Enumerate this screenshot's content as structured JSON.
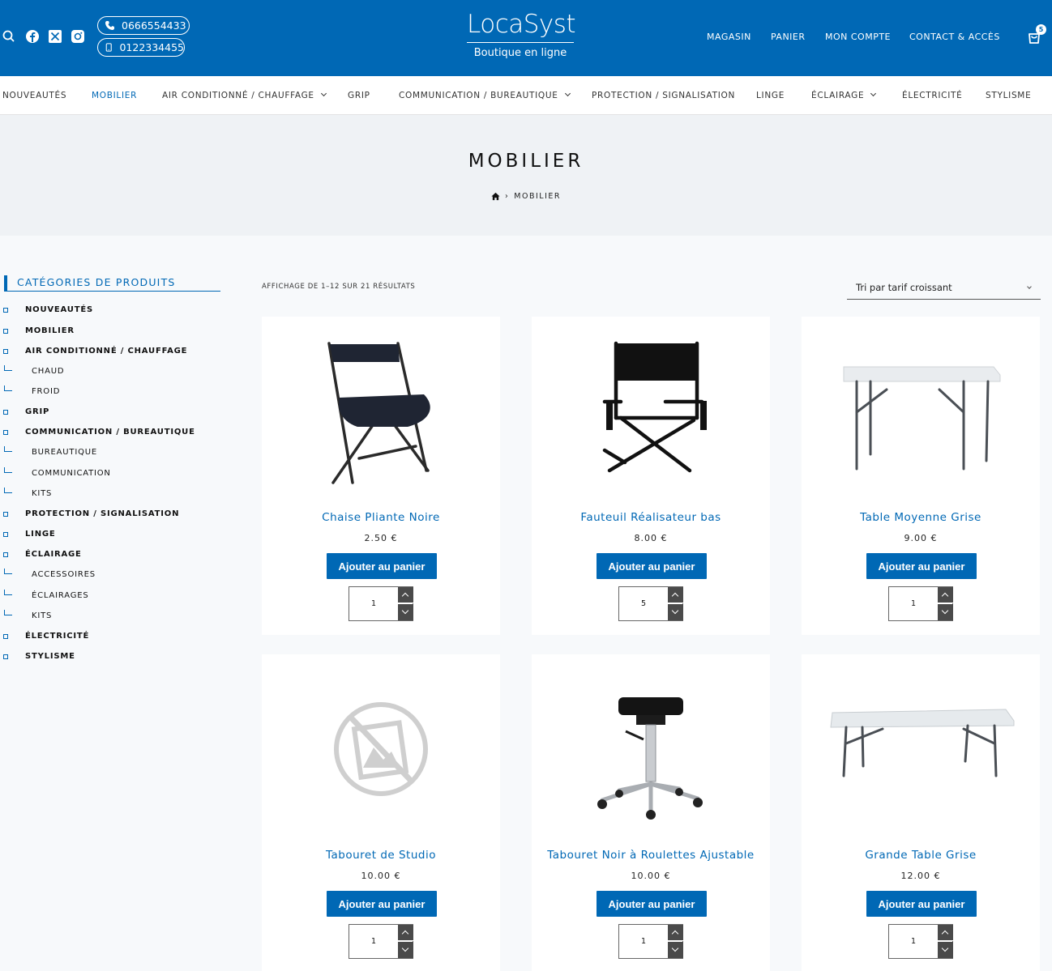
{
  "header": {
    "phone": "0666554433",
    "mobile": "0122334455",
    "logo_name": "LocaSyst",
    "logo_tagline": "Boutique en ligne",
    "nav": [
      "MAGASIN",
      "PANIER",
      "MON COMPTE",
      "CONTACT & ACCÈS"
    ],
    "cart_count": "5",
    "accent_color": "#0068b5"
  },
  "catnav": [
    "NOUVEAUTÉS",
    "MOBILIER",
    "AIR CONDITIONNÉ / CHAUFFAGE",
    "GRIP",
    "COMMUNICATION / BUREAUTIQUE",
    "PROTECTION / SIGNALISATION",
    "LINGE",
    "ÉCLAIRAGE",
    "ÉLECTRICITÉ",
    "STYLISME"
  ],
  "page": {
    "title": "MOBILIER",
    "breadcrumb": "MOBILIER"
  },
  "sidebar": {
    "title": "CATÉGORIES DE PRODUITS",
    "items": [
      "NOUVEAUTÉS",
      "MOBILIER",
      "AIR CONDITIONNÉ / CHAUFFAGE",
      "CHAUD",
      "FROID",
      "GRIP",
      "COMMUNICATION / BUREAUTIQUE",
      "BUREAUTIQUE",
      "COMMUNICATION",
      "KITS",
      "PROTECTION / SIGNALISATION",
      "LINGE",
      "ÉCLAIRAGE",
      "ACCESSOIRES",
      "ÉCLAIRAGES",
      "KITS",
      "ÉLECTRICITÉ",
      "STYLISME"
    ]
  },
  "toolbar": {
    "results": "AFFICHAGE DE 1–12 SUR 21 RÉSULTATS",
    "sort": "Tri par tarif croissant"
  },
  "products": [
    {
      "name": "Chaise Pliante Noire",
      "price": "2.50 €",
      "button": "Ajouter au panier",
      "qty": "1"
    },
    {
      "name": "Fauteuil Réalisateur bas",
      "price": "8.00 €",
      "button": "Ajouter au panier",
      "qty": "5"
    },
    {
      "name": "Table Moyenne Grise",
      "price": "9.00 €",
      "button": "Ajouter au panier",
      "qty": "1"
    },
    {
      "name": "Tabouret de Studio",
      "price": "10.00 €",
      "button": "Ajouter au panier",
      "qty": "1"
    },
    {
      "name": "Tabouret Noir à Roulettes Ajustable",
      "price": "10.00 €",
      "button": "Ajouter au panier",
      "qty": "1"
    },
    {
      "name": "Grande Table Grise",
      "price": "12.00 €",
      "button": "Ajouter au panier",
      "qty": "1"
    }
  ]
}
